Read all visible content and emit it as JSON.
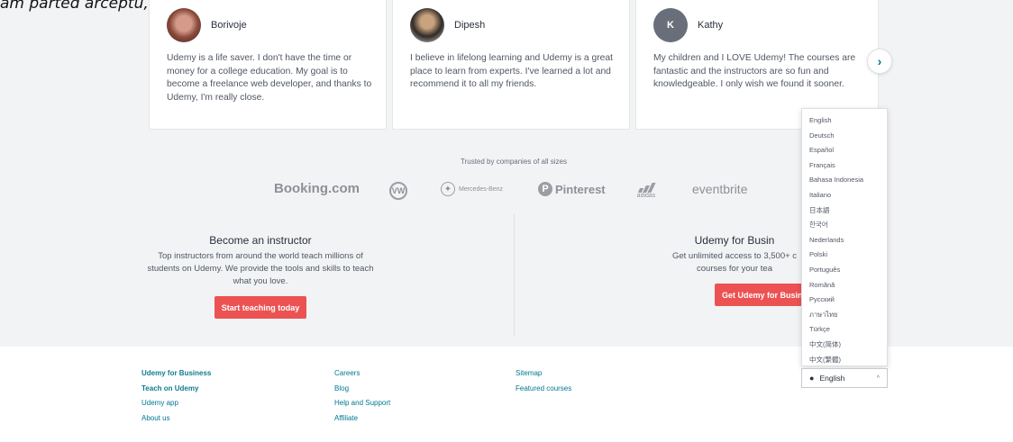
{
  "caption": "am parted arceptu, jos a pagini",
  "testimonials": [
    {
      "name": "Borivoje",
      "avatar": "photo",
      "quote": "Udemy is a life saver. I don't have the time or money for a college education. My goal is to become a freelance web developer, and thanks to Udemy, I'm really close."
    },
    {
      "name": "Dipesh",
      "avatar": "photo",
      "quote": "I believe in lifelong learning and Udemy is a great place to learn from experts. I've learned a lot and recommend it to all my friends."
    },
    {
      "name": "Kathy",
      "avatar_letter": "K",
      "quote": "My children and I LOVE Udemy! The courses are fantastic and the instructors are so fun and knowledgeable. I only wish we found it sooner."
    }
  ],
  "next_icon": "chevron-right-icon",
  "trusted": {
    "label": "Trusted by companies of all sizes",
    "logos": {
      "booking": "Booking.com",
      "vw": "VW",
      "mercedes": "Mercedes-Benz",
      "pinterest": "Pinterest",
      "adidas": "adidas",
      "eventbrite": "eventbrite"
    }
  },
  "instructor": {
    "title": "Become an instructor",
    "description": "Top instructors from around the world teach millions of students on Udemy. We provide the tools and skills to teach what you love.",
    "button": "Start teaching today"
  },
  "business": {
    "title": "Udemy for Busin",
    "description_line1": "Get unlimited access to 3,500+ c",
    "description_line2": "courses for your tea",
    "button": "Get Udemy for Busin"
  },
  "footer": {
    "col1": [
      "Udemy for Business",
      "Teach on Udemy",
      "Udemy app",
      "About us"
    ],
    "col2": [
      "Careers",
      "Blog",
      "Help and Support",
      "Affiliate"
    ],
    "col3": [
      "Sitemap",
      "Featured courses"
    ]
  },
  "language_menu": [
    "English",
    "Deutsch",
    "Español",
    "Français",
    "Bahasa Indonesia",
    "Italiano",
    "日本語",
    "한국어",
    "Nederlands",
    "Polski",
    "Português",
    "Română",
    "Русский",
    "ภาษาไทย",
    "Türkçe",
    "中文(简体)",
    "中文(繁體)"
  ],
  "language_select": {
    "value": "English",
    "icon": "globe-icon",
    "caret": "chevron-up-icon"
  },
  "colors": {
    "accent": "#ec5252",
    "link": "#007791",
    "band": "#f2f3f5"
  }
}
